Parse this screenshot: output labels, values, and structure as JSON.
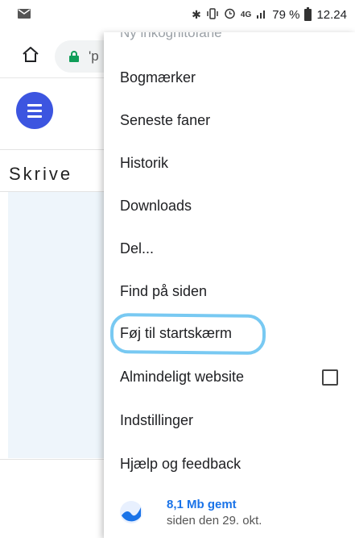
{
  "status_bar": {
    "battery_percent": "79 %",
    "time": "12.24",
    "network_type": "4G",
    "icons": [
      "mail-icon",
      "bluetooth-icon",
      "vibrate-icon",
      "alarm-icon",
      "network-4g-icon",
      "signal-icon",
      "battery-icon"
    ]
  },
  "toolbar": {
    "url_text": "'p"
  },
  "page": {
    "title": "Skrive"
  },
  "menu": {
    "cut_off_item": "Ny inkognitofane",
    "items": [
      {
        "label": "Bogmærker"
      },
      {
        "label": "Seneste faner"
      },
      {
        "label": "Historik"
      },
      {
        "label": "Downloads"
      },
      {
        "label": "Del..."
      },
      {
        "label": "Find på siden"
      },
      {
        "label": "Føj til startskærm"
      },
      {
        "label": "Almindeligt website",
        "checked": false
      },
      {
        "label": "Indstillinger"
      },
      {
        "label": "Hjælp og feedback"
      }
    ],
    "footer": {
      "title": "8,1 Mb gemt",
      "subtitle": "siden den 29. okt."
    }
  },
  "colors": {
    "accent": "#3c55e0",
    "highlight": "#78c9f2",
    "link": "#1a73e8",
    "lock": "#0f9d58"
  }
}
